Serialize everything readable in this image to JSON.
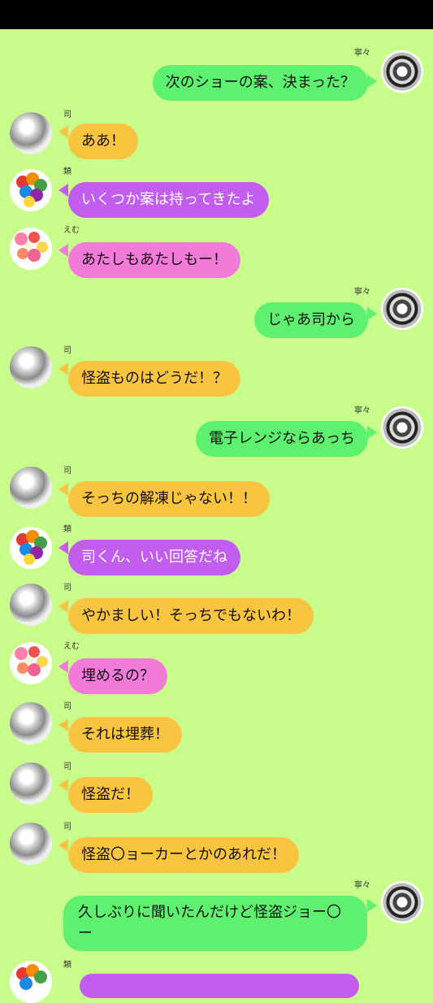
{
  "names": {
    "nene": "寧々",
    "tsukasa": "司",
    "rui": "類",
    "emu": "えむ"
  },
  "messages": [
    {
      "text": "次のショーの案、決まった？"
    },
    {
      "text": "ああ！"
    },
    {
      "text": "いくつか案は持ってきたよ"
    },
    {
      "text": "あたしもあたしもー！"
    },
    {
      "text": "じゃあ司から"
    },
    {
      "text": "怪盗ものはどうだ！？"
    },
    {
      "text": "電子レンジならあっち"
    },
    {
      "text": "そっちの解凍じゃない！！"
    },
    {
      "text": "司くん、いい回答だね"
    },
    {
      "text": "やかましい！そっちでもないわ！"
    },
    {
      "text": "埋めるの？"
    },
    {
      "text": "それは埋葬！"
    },
    {
      "text": "怪盗だ！"
    },
    {
      "text": "怪盗〇ョーカーとかのあれだ！"
    },
    {
      "text": "久しぶりに聞いたんだけど怪盗ジョー〇ー"
    }
  ],
  "colors": {
    "background": "#c8fd8c",
    "nene_bubble": "#5ef16f",
    "tsukasa_bubble": "#f9c540",
    "rui_bubble": "#c25df0",
    "emu_bubble": "#f27ad8"
  },
  "icons": {
    "nene_avatar": "gear-avatar-icon",
    "tsukasa_avatar": "gray-photo-avatar-icon",
    "rui_avatar": "balloon-avatar-icon",
    "emu_avatar": "candy-avatar-icon"
  }
}
